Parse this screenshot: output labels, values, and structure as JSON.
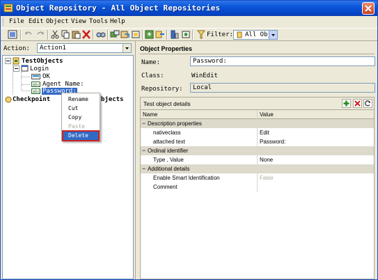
{
  "window": {
    "title": "Object Repository - All Object Repositories"
  },
  "menu": [
    {
      "label": "File"
    },
    {
      "label": "Edit"
    },
    {
      "label": "Object"
    },
    {
      "label": "View"
    },
    {
      "label": "Tools"
    },
    {
      "label": "Help"
    }
  ],
  "toolbar": {
    "filter_label": "Filter:",
    "filter_value": "All Obje"
  },
  "left": {
    "action_label": "Action:",
    "action_value": "Action1",
    "tree": {
      "root": "TestObjects",
      "login": "Login",
      "ok": "OK",
      "agent_name": "Agent Name:",
      "password": "Password:",
      "checkpoints": "Checkpoint",
      "checkpoints_tail": "bjects"
    },
    "context_menu": [
      "Rename",
      "Cut",
      "Copy",
      "Paste",
      "Delete"
    ]
  },
  "properties": {
    "header": "Object Properties",
    "name_label": "Name:",
    "name_value": "Password:",
    "class_label": "Class:",
    "class_value": "WinEdit",
    "repository_label": "Repository:",
    "repository_value": "Local"
  },
  "details": {
    "title": "Test object details",
    "columns": [
      "Name",
      "Value"
    ],
    "rows": [
      {
        "name": "Description properties",
        "value": "",
        "group": true
      },
      {
        "name": "nativeclass",
        "value": "Edit"
      },
      {
        "name": "attached text",
        "value": "Password:"
      },
      {
        "name": "Ordinal identifier",
        "value": "",
        "group": true
      },
      {
        "name": "Type , Value",
        "value": "None"
      },
      {
        "name": "Additional details",
        "value": "",
        "group": true
      },
      {
        "name": "Enable Smart Identification",
        "value": "False"
      },
      {
        "name": "Comment",
        "value": ""
      }
    ]
  }
}
